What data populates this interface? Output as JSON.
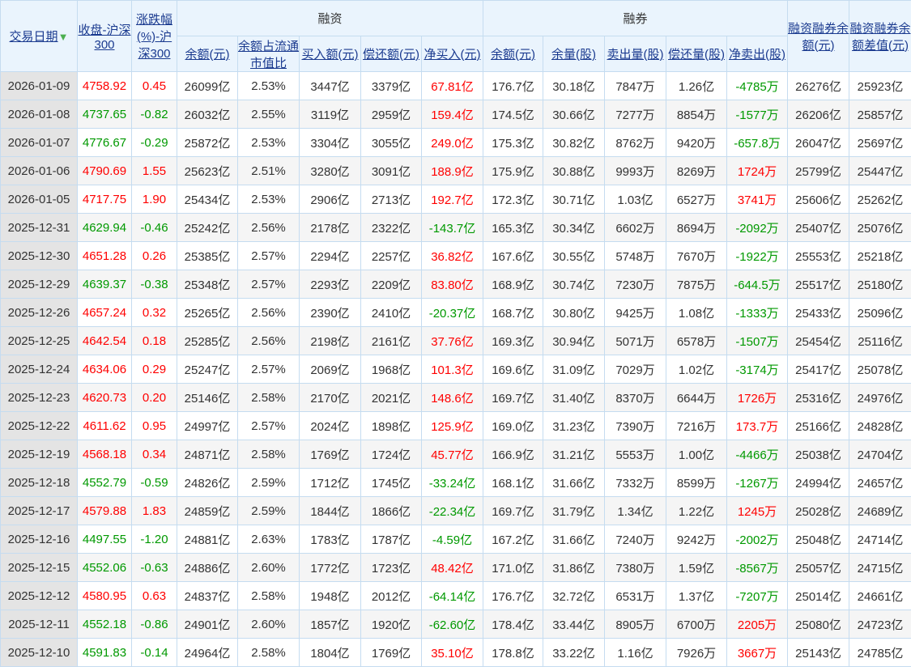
{
  "headers": {
    "date": "交易日期",
    "sort_icon": "sort-down-arrow-icon",
    "close": "收盘-沪深300",
    "change": "涨跌幅(%)-沪深300",
    "margin_group": "融资",
    "short_group": "融券",
    "m_balance": "余额(元)",
    "m_ratio": "余额占流通市值比",
    "m_buy": "买入额(元)",
    "m_repay": "偿还额(元)",
    "m_net": "净买入(元)",
    "s_balance": "余额(元)",
    "s_volume": "余量(股)",
    "s_sell": "卖出量(股)",
    "s_repay": "偿还量(股)",
    "s_net": "净卖出(股)",
    "total": "融资融券余额(元)",
    "diff": "融资融券余额差值(元)"
  },
  "colors": {
    "up": "#ff0000",
    "down": "#009900"
  },
  "rows": [
    [
      "2026-01-09",
      "4758.92",
      "0.45",
      "26099亿",
      "2.53%",
      "3447亿",
      "3379亿",
      "67.81亿",
      "176.7亿",
      "30.18亿",
      "7847万",
      "1.26亿",
      "-4785万",
      "26276亿",
      "25923亿"
    ],
    [
      "2026-01-08",
      "4737.65",
      "-0.82",
      "26032亿",
      "2.55%",
      "3119亿",
      "2959亿",
      "159.4亿",
      "174.5亿",
      "30.66亿",
      "7277万",
      "8854万",
      "-1577万",
      "26206亿",
      "25857亿"
    ],
    [
      "2026-01-07",
      "4776.67",
      "-0.29",
      "25872亿",
      "2.53%",
      "3304亿",
      "3055亿",
      "249.0亿",
      "175.3亿",
      "30.82亿",
      "8762万",
      "9420万",
      "-657.8万",
      "26047亿",
      "25697亿"
    ],
    [
      "2026-01-06",
      "4790.69",
      "1.55",
      "25623亿",
      "2.51%",
      "3280亿",
      "3091亿",
      "188.9亿",
      "175.9亿",
      "30.88亿",
      "9993万",
      "8269万",
      "1724万",
      "25799亿",
      "25447亿"
    ],
    [
      "2026-01-05",
      "4717.75",
      "1.90",
      "25434亿",
      "2.53%",
      "2906亿",
      "2713亿",
      "192.7亿",
      "172.3亿",
      "30.71亿",
      "1.03亿",
      "6527万",
      "3741万",
      "25606亿",
      "25262亿"
    ],
    [
      "2025-12-31",
      "4629.94",
      "-0.46",
      "25242亿",
      "2.56%",
      "2178亿",
      "2322亿",
      "-143.7亿",
      "165.3亿",
      "30.34亿",
      "6602万",
      "8694万",
      "-2092万",
      "25407亿",
      "25076亿"
    ],
    [
      "2025-12-30",
      "4651.28",
      "0.26",
      "25385亿",
      "2.57%",
      "2294亿",
      "2257亿",
      "36.82亿",
      "167.6亿",
      "30.55亿",
      "5748万",
      "7670万",
      "-1922万",
      "25553亿",
      "25218亿"
    ],
    [
      "2025-12-29",
      "4639.37",
      "-0.38",
      "25348亿",
      "2.57%",
      "2293亿",
      "2209亿",
      "83.80亿",
      "168.9亿",
      "30.74亿",
      "7230万",
      "7875万",
      "-644.5万",
      "25517亿",
      "25180亿"
    ],
    [
      "2025-12-26",
      "4657.24",
      "0.32",
      "25265亿",
      "2.56%",
      "2390亿",
      "2410亿",
      "-20.37亿",
      "168.7亿",
      "30.80亿",
      "9425万",
      "1.08亿",
      "-1333万",
      "25433亿",
      "25096亿"
    ],
    [
      "2025-12-25",
      "4642.54",
      "0.18",
      "25285亿",
      "2.56%",
      "2198亿",
      "2161亿",
      "37.76亿",
      "169.3亿",
      "30.94亿",
      "5071万",
      "6578万",
      "-1507万",
      "25454亿",
      "25116亿"
    ],
    [
      "2025-12-24",
      "4634.06",
      "0.29",
      "25247亿",
      "2.57%",
      "2069亿",
      "1968亿",
      "101.3亿",
      "169.6亿",
      "31.09亿",
      "7029万",
      "1.02亿",
      "-3174万",
      "25417亿",
      "25078亿"
    ],
    [
      "2025-12-23",
      "4620.73",
      "0.20",
      "25146亿",
      "2.58%",
      "2170亿",
      "2021亿",
      "148.6亿",
      "169.7亿",
      "31.40亿",
      "8370万",
      "6644万",
      "1726万",
      "25316亿",
      "24976亿"
    ],
    [
      "2025-12-22",
      "4611.62",
      "0.95",
      "24997亿",
      "2.57%",
      "2024亿",
      "1898亿",
      "125.9亿",
      "169.0亿",
      "31.23亿",
      "7390万",
      "7216万",
      "173.7万",
      "25166亿",
      "24828亿"
    ],
    [
      "2025-12-19",
      "4568.18",
      "0.34",
      "24871亿",
      "2.58%",
      "1769亿",
      "1724亿",
      "45.77亿",
      "166.9亿",
      "31.21亿",
      "5553万",
      "1.00亿",
      "-4466万",
      "25038亿",
      "24704亿"
    ],
    [
      "2025-12-18",
      "4552.79",
      "-0.59",
      "24826亿",
      "2.59%",
      "1712亿",
      "1745亿",
      "-33.24亿",
      "168.1亿",
      "31.66亿",
      "7332万",
      "8599万",
      "-1267万",
      "24994亿",
      "24657亿"
    ],
    [
      "2025-12-17",
      "4579.88",
      "1.83",
      "24859亿",
      "2.59%",
      "1844亿",
      "1866亿",
      "-22.34亿",
      "169.7亿",
      "31.79亿",
      "1.34亿",
      "1.22亿",
      "1245万",
      "25028亿",
      "24689亿"
    ],
    [
      "2025-12-16",
      "4497.55",
      "-1.20",
      "24881亿",
      "2.63%",
      "1783亿",
      "1787亿",
      "-4.59亿",
      "167.2亿",
      "31.66亿",
      "7240万",
      "9242万",
      "-2002万",
      "25048亿",
      "24714亿"
    ],
    [
      "2025-12-15",
      "4552.06",
      "-0.63",
      "24886亿",
      "2.60%",
      "1772亿",
      "1723亿",
      "48.42亿",
      "171.0亿",
      "31.86亿",
      "7380万",
      "1.59亿",
      "-8567万",
      "25057亿",
      "24715亿"
    ],
    [
      "2025-12-12",
      "4580.95",
      "0.63",
      "24837亿",
      "2.58%",
      "1948亿",
      "2012亿",
      "-64.14亿",
      "176.7亿",
      "32.72亿",
      "6531万",
      "1.37亿",
      "-7207万",
      "25014亿",
      "24661亿"
    ],
    [
      "2025-12-11",
      "4552.18",
      "-0.86",
      "24901亿",
      "2.60%",
      "1857亿",
      "1920亿",
      "-62.60亿",
      "178.4亿",
      "33.44亿",
      "8905万",
      "6700万",
      "2205万",
      "25080亿",
      "24723亿"
    ],
    [
      "2025-12-10",
      "4591.83",
      "-0.14",
      "24964亿",
      "2.58%",
      "1804亿",
      "1769亿",
      "35.10亿",
      "178.8亿",
      "33.22亿",
      "1.16亿",
      "7926万",
      "3667万",
      "25143亿",
      "24785亿"
    ]
  ]
}
